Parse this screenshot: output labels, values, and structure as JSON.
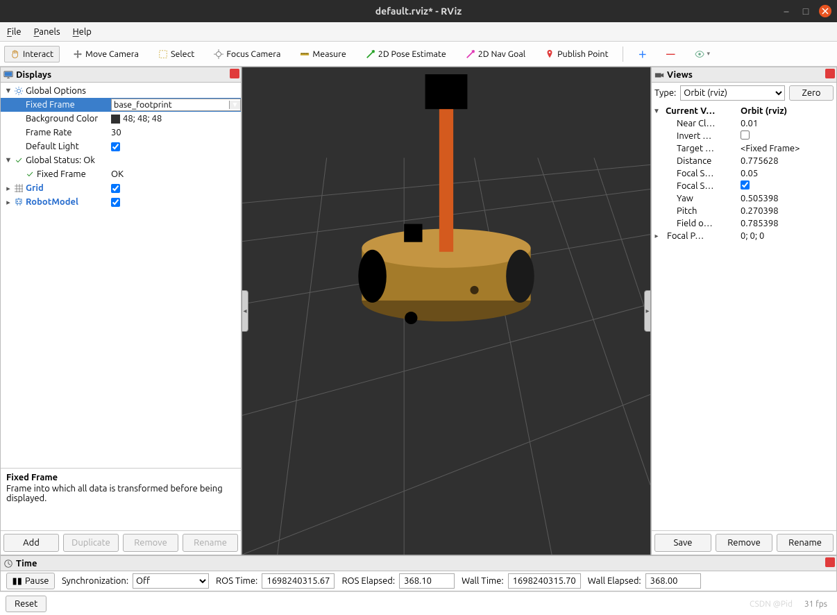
{
  "window": {
    "title": "default.rviz* - RViz",
    "minimize": "–",
    "maximize": "□",
    "close": "×"
  },
  "menubar": {
    "file": "File",
    "panels": "Panels",
    "help": "Help"
  },
  "toolbar": {
    "interact": "Interact",
    "move_camera": "Move Camera",
    "select": "Select",
    "focus_camera": "Focus Camera",
    "measure": "Measure",
    "pose_estimate": "2D Pose Estimate",
    "nav_goal": "2D Nav Goal",
    "publish_point": "Publish Point"
  },
  "displays": {
    "title": "Displays",
    "global_options": "Global Options",
    "fixed_frame_label": "Fixed Frame",
    "fixed_frame_value": "base_footprint",
    "bg_color_label": "Background Color",
    "bg_color_value": "48; 48; 48",
    "frame_rate_label": "Frame Rate",
    "frame_rate_value": "30",
    "default_light_label": "Default Light",
    "global_status": "Global Status: Ok",
    "status_frame_label": "Fixed Frame",
    "status_frame_value": "OK",
    "grid": "Grid",
    "robot_model": "RobotModel",
    "help_title": "Fixed Frame",
    "help_body": "Frame into which all data is transformed before being displayed.",
    "btn_add": "Add",
    "btn_duplicate": "Duplicate",
    "btn_remove": "Remove",
    "btn_rename": "Rename"
  },
  "views": {
    "title": "Views",
    "type_label": "Type:",
    "type_value": "Orbit (rviz)",
    "zero": "Zero",
    "current_label": "Current V…",
    "current_value": "Orbit (rviz)",
    "near_clip_l": "Near Cl…",
    "near_clip_v": "0.01",
    "invert_l": "Invert …",
    "target_l": "Target …",
    "target_v": "<Fixed Frame>",
    "distance_l": "Distance",
    "distance_v": "0.775628",
    "focal_sh_l": "Focal S…",
    "focal_sh_v": "0.05",
    "focal_sf_l": "Focal S…",
    "yaw_l": "Yaw",
    "yaw_v": "0.505398",
    "pitch_l": "Pitch",
    "pitch_v": "0.270398",
    "fov_l": "Field o…",
    "fov_v": "0.785398",
    "focal_p_l": "Focal P…",
    "focal_p_v": "0; 0; 0",
    "btn_save": "Save",
    "btn_remove": "Remove",
    "btn_rename": "Rename"
  },
  "time": {
    "title": "Time",
    "pause": "Pause",
    "sync_label": "Synchronization:",
    "sync_value": "Off",
    "ros_time_l": "ROS Time:",
    "ros_time_v": "1698240315.67",
    "ros_elapsed_l": "ROS Elapsed:",
    "ros_elapsed_v": "368.10",
    "wall_time_l": "Wall Time:",
    "wall_time_v": "1698240315.70",
    "wall_elapsed_l": "Wall Elapsed:",
    "wall_elapsed_v": "368.00"
  },
  "status": {
    "reset": "Reset",
    "fps": "31 fps",
    "watermark": "CSDN @Pid"
  }
}
